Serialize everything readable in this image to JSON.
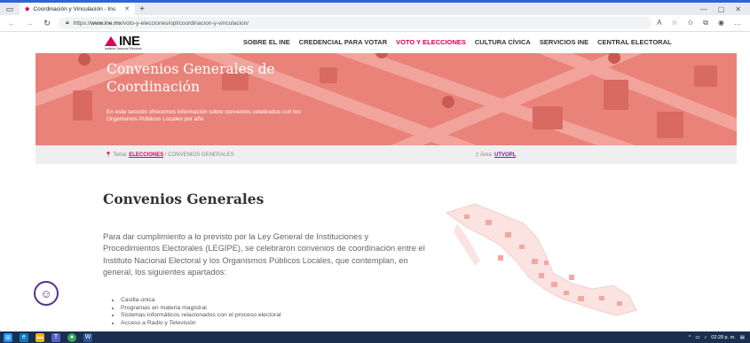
{
  "browser": {
    "tab_title": "Coordinación y Vinculación - Ins",
    "url_scheme": "https://",
    "url_host": "www.ine.mx",
    "url_path": "/voto-y-elecciones/opl/coordinacion-y-vinculacion/",
    "icons": [
      "menu-icon",
      "back-icon",
      "forward-icon",
      "refresh-icon",
      "lock-icon",
      "read-aloud-icon",
      "favorites-icon",
      "collections-icon",
      "profile-icon",
      "more-icon"
    ]
  },
  "header": {
    "logo_text": "INE",
    "logo_subtext": "Instituto Nacional Electoral",
    "nav": [
      {
        "label": "SOBRE EL INE",
        "active": false
      },
      {
        "label": "CREDENCIAL PARA VOTAR",
        "active": false
      },
      {
        "label": "VOTO Y ELECCIONES",
        "active": true
      },
      {
        "label": "CULTURA CÍVICA",
        "active": false
      },
      {
        "label": "SERVICIOS INE",
        "active": false
      },
      {
        "label": "CENTRAL ELECTORAL",
        "active": false
      }
    ],
    "accent_color": "#d6005a"
  },
  "hero": {
    "title": "Convenios Generales de Coordinación",
    "description": "En esta sección ofrecemos información sobre convenios celebrados con los Organismos Públicos Locales por año",
    "background_color": "#e9837a"
  },
  "breadcrumb": {
    "tema_prefix": "Tema:",
    "tema_link": "ELECCIONES",
    "separator": "/",
    "current": "CONVENIOS GENERALES",
    "area_prefix": "Área:",
    "area_link": "UTVOPL"
  },
  "main": {
    "title": "Convenios Generales",
    "paragraph": "Para dar cumplimiento a lo previsto por la Ley General de Instituciones y Procedimientos Electorales (LEGIPE), se celebraron convenios de coordinación entre el Instituto Nacional Electoral y los Organismos Públicos Locales, que contemplan, en general, los siguientes apartados:",
    "bullets": [
      "Casilla única",
      "Programas en materia magistral",
      "Sistemas informáticos relacionados con el proceso electoral",
      "Acceso a Radio y Televisión"
    ]
  },
  "taskbar": {
    "time": "02:28 p. m.",
    "apps": [
      "windows-start-icon",
      "edge-icon",
      "file-explorer-icon",
      "teams-icon",
      "chrome-icon",
      "word-icon"
    ]
  }
}
